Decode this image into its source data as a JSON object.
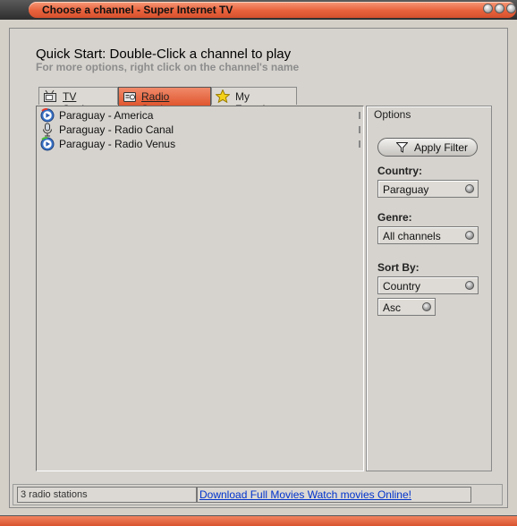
{
  "window": {
    "title": "Choose a channel - Super Internet TV",
    "controls": [
      "minimize-icon",
      "maximize-icon",
      "close-icon"
    ]
  },
  "header": {
    "title": "Quick Start: Double-Click a channel to play",
    "subtitle": "For more options, right click on the channel's name"
  },
  "tabs": [
    {
      "label": "TV Stations",
      "icon": "tv-icon",
      "active": false
    },
    {
      "label": "Radio Stations",
      "icon": "radio-icon",
      "active": true
    },
    {
      "label": "My Favorites",
      "icon": "star-icon",
      "active": false
    }
  ],
  "channels": [
    {
      "name": "Paraguay - America",
      "icon": "play-icon"
    },
    {
      "name": "Paraguay - Radio Canal",
      "icon": "microphone-icon"
    },
    {
      "name": "Paraguay - Radio Venus",
      "icon": "play-icon"
    }
  ],
  "options": {
    "legend": "Options",
    "apply_filter_label": "Apply Filter",
    "country_label": "Country:",
    "country_value": "Paraguay",
    "genre_label": "Genre:",
    "genre_value": "All channels",
    "sort_label": "Sort By:",
    "sort_value": "Country",
    "order_value": "Asc"
  },
  "status": {
    "count_text": "3 radio stations",
    "promo_link": "Download Full Movies  Watch movies Online!"
  },
  "colors": {
    "accent": "#e8623c",
    "frame": "#d6d3ce",
    "link": "#0033cc"
  }
}
